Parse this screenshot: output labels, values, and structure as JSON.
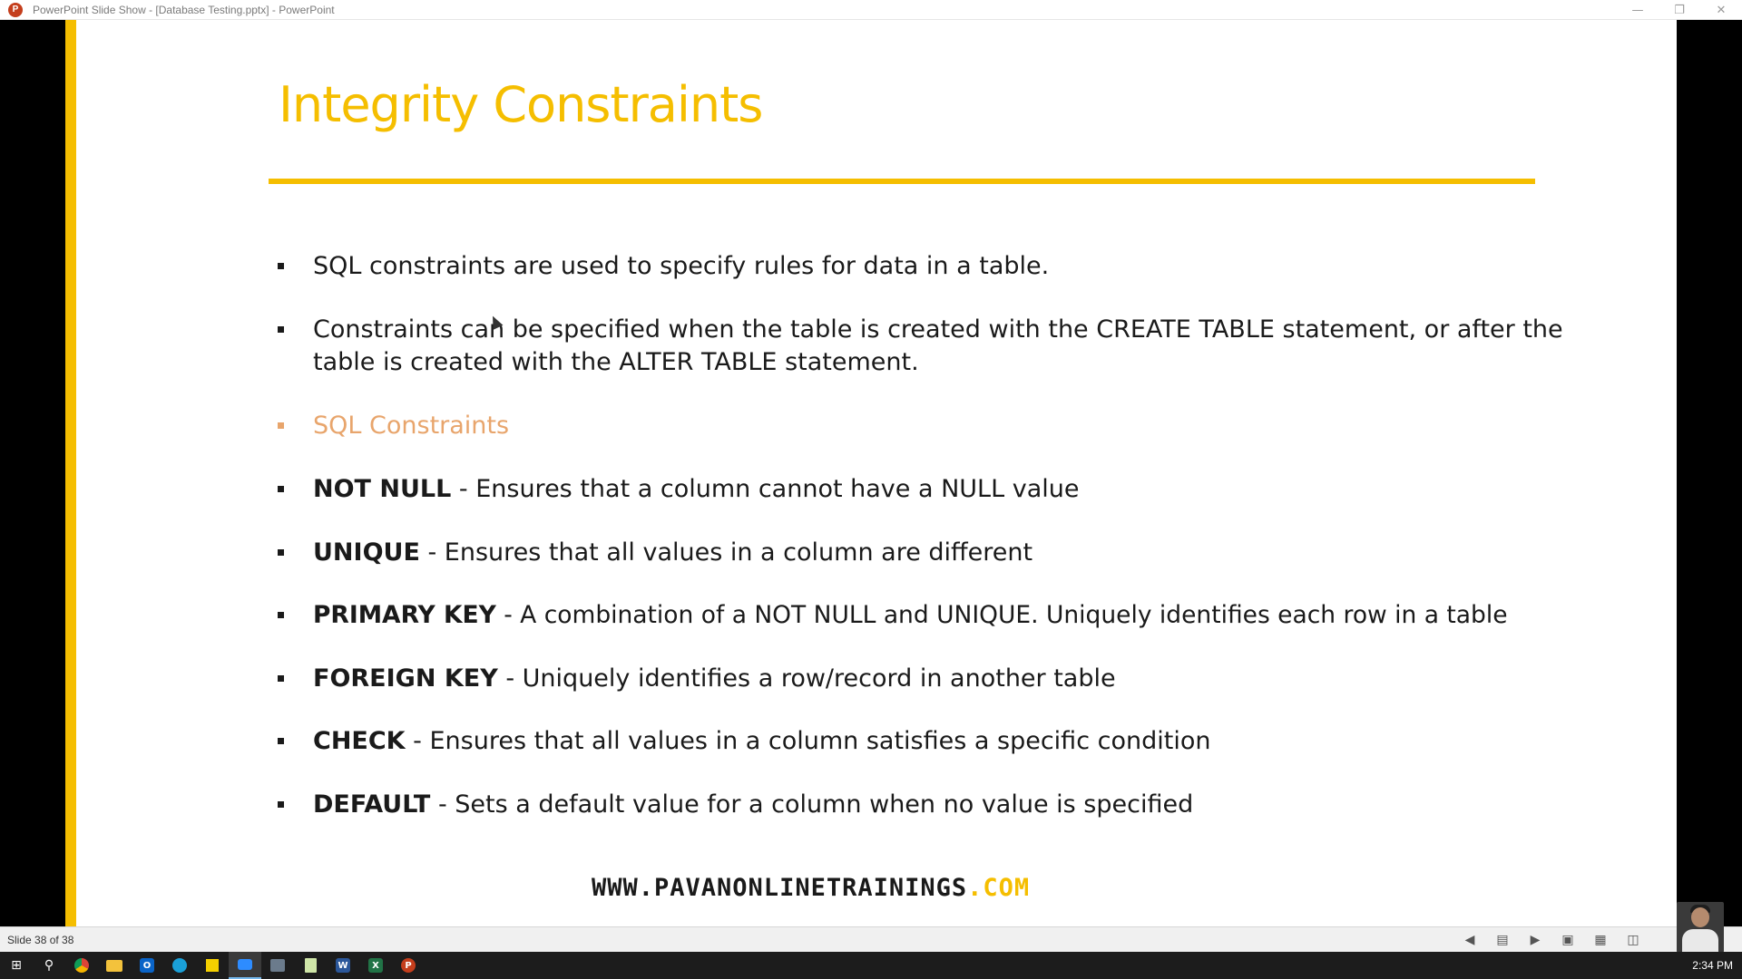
{
  "window": {
    "title": "PowerPoint Slide Show - [Database Testing.pptx] - PowerPoint",
    "app_badge": "P",
    "controls": [
      "minimize-icon",
      "restore-icon",
      "close-icon"
    ]
  },
  "slide": {
    "title": "Integrity Constraints",
    "bullets": [
      {
        "bold": "",
        "text": "SQL constraints are used to specify rules for data in a table."
      },
      {
        "bold": "",
        "text": "Constraints can be specified when the table is created with the CREATE TABLE statement, or after the table is created with the ALTER TABLE statement."
      },
      {
        "bold": "",
        "text": "SQL Constraints"
      },
      {
        "bold": "NOT NULL",
        "text": " - Ensures that a column cannot have a NULL value"
      },
      {
        "bold": "UNIQUE",
        "text": " - Ensures that all values in a column are different"
      },
      {
        "bold": "PRIMARY KEY",
        "text": " - A combination of a NOT NULL and UNIQUE. Uniquely identifies each row in a table"
      },
      {
        "bold": "FOREIGN KEY",
        "text": " - Uniquely identifies a row/record in another table"
      },
      {
        "bold": "CHECK",
        "text": " - Ensures that all values in a column satisfies a specific condition"
      },
      {
        "bold": "DEFAULT",
        "text": " - Sets a default value for a column when no value is specified"
      }
    ],
    "footer_url": "WWW.PAVANONLINETRAININGS",
    "footer_tld": ".COM",
    "colors": {
      "accent": "#f5be00",
      "subheading": "#e8a56c",
      "text": "#1a1a1a"
    }
  },
  "status": {
    "slide_counter": "Slide 38 of 38",
    "icons": [
      "previous-slide-icon",
      "menu-icon",
      "next-slide-icon",
      "normal-view-icon",
      "slide-sorter-icon",
      "reading-view-icon"
    ]
  },
  "taskbar": {
    "apps": [
      "start-icon",
      "search-icon",
      "chrome-icon",
      "file-explorer-icon",
      "outlook-icon",
      "edge-icon",
      "sticky-notes-icon",
      "zoom-icon",
      "mysql-workbench-icon",
      "notepad-icon",
      "word-icon",
      "excel-icon",
      "powerpoint-icon"
    ],
    "outlook_badge": "O",
    "word_badge": "W",
    "excel_badge": "X",
    "powerpoint_badge": "P",
    "time": "2:34 PM"
  }
}
